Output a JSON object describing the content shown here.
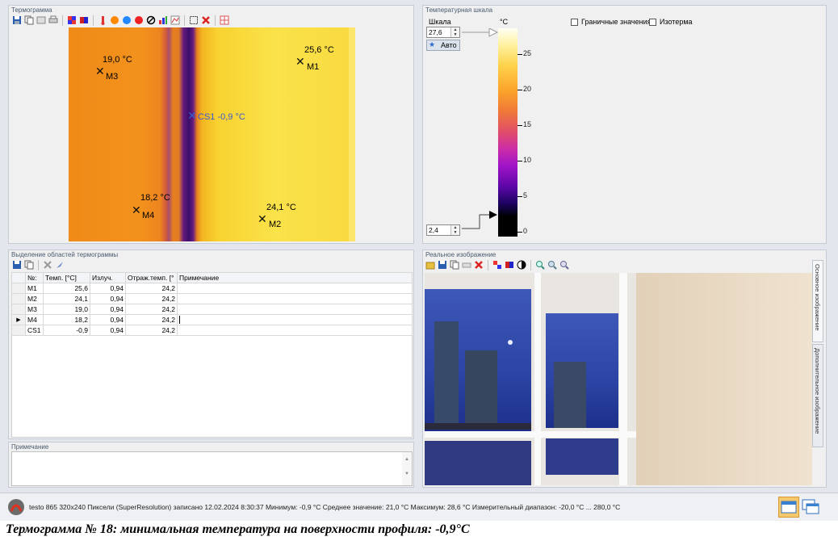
{
  "panels": {
    "thermogram_title": "Термограмма",
    "scale_title": "Температурная шкала",
    "areas_title": "Выделение областей термограммы",
    "note_title": "Примечание",
    "photo_title": "Реальное изображение"
  },
  "markers": [
    {
      "id": "M1",
      "label": "25,6 °C"
    },
    {
      "id": "M2",
      "label": "24,1 °C"
    },
    {
      "id": "M3",
      "label": "19,0 °C"
    },
    {
      "id": "M4",
      "label": "18,2 °C"
    },
    {
      "id": "CS1",
      "label": "CS1 -0,9 °C"
    }
  ],
  "scale": {
    "label": "Шкала",
    "unit": "°C",
    "max_value": "27,6",
    "min_value": "2,4",
    "auto_button": "Авто",
    "boundary_values": "Граничные значения",
    "isotherm": "Изотерма",
    "ticks": [
      "25",
      "20",
      "15",
      "10",
      "5",
      "0"
    ]
  },
  "table": {
    "headers": [
      "№:",
      "Темп. [°C]",
      "Излуч.",
      "Отраж.темп. [°",
      "Примечание"
    ],
    "rows": [
      [
        "M1",
        "25,6",
        "0,94",
        "24,2",
        ""
      ],
      [
        "M2",
        "24,1",
        "0,94",
        "24,2",
        ""
      ],
      [
        "M3",
        "19,0",
        "0,94",
        "24,2",
        ""
      ],
      [
        "M4",
        "18,2",
        "0,94",
        "24,2",
        ""
      ],
      [
        "CS1",
        "-0,9",
        "0,94",
        "24,2",
        ""
      ]
    ],
    "selected_row": 3
  },
  "side_tabs": {
    "main": "Основное изображение",
    "extra": "Дополнительное изображение"
  },
  "status": "testo 865 320x240 Пиксели (SuperResolution) записано 12.02.2024 8:30:37 Минимум: -0,9 °C Среднее значение: 21,0 °C Максимум: 28,6 °C Измерительный диапазон: -20,0 °C ... 280,0 °C",
  "caption": "Термограмма № 18: минимальная температура на поверхности профиля: -0,9°С",
  "colors": {
    "window_bg": "#e3e7ed",
    "panel_bg": "#f0f0f0",
    "title_text": "#4a5a6f"
  }
}
